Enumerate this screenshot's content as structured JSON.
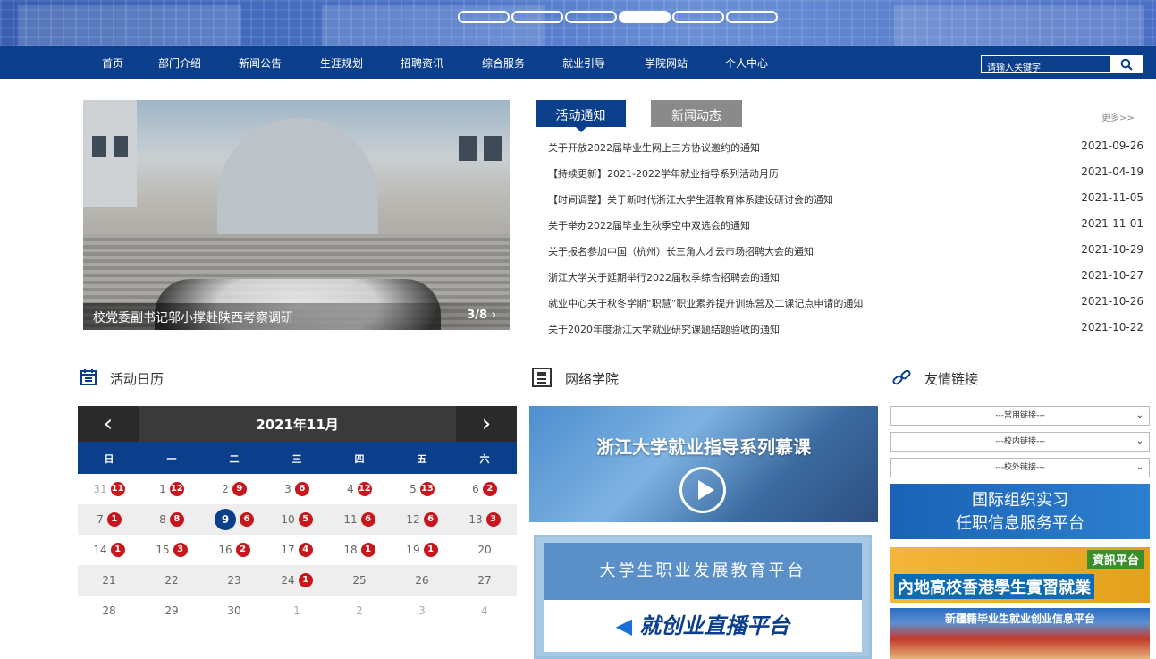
{
  "banner": {
    "dots": [
      false,
      false,
      false,
      true,
      false,
      false
    ]
  },
  "nav": {
    "items": [
      "首页",
      "部门介绍",
      "新闻公告",
      "生涯规划",
      "招聘资讯",
      "综合服务",
      "就业引导",
      "学院网站",
      "个人中心"
    ],
    "search_placeholder": "请输入关键字"
  },
  "slider": {
    "caption": "校党委副书记邬小撑赴陕西考察调研",
    "pager": "3/8"
  },
  "news": {
    "tabs": [
      "活动通知",
      "新闻动态"
    ],
    "more": "更多>>",
    "items": [
      {
        "title": "关于开放2022届毕业生网上三方协议邀约的通知",
        "date": "2021-09-26"
      },
      {
        "title": "【持续更新】2021-2022学年就业指导系列活动月历",
        "date": "2021-04-19"
      },
      {
        "title": "【时间调整】关于新时代浙江大学生涯教育体系建设研讨会的通知",
        "date": "2021-11-05"
      },
      {
        "title": "关于举办2022届毕业生秋季空中双选会的通知",
        "date": "2021-11-01"
      },
      {
        "title": "关于报名参加中国（杭州）长三角人才云市场招聘大会的通知",
        "date": "2021-10-29"
      },
      {
        "title": "浙江大学关于延期举行2022届秋季综合招聘会的通知",
        "date": "2021-10-27"
      },
      {
        "title": "就业中心关于秋冬学期“职慧”职业素养提升训练营及二课记点申请的通知",
        "date": "2021-10-26"
      },
      {
        "title": "关于2020年度浙江大学就业研究课题结题验收的通知",
        "date": "2021-10-22"
      }
    ]
  },
  "sections": {
    "calendar": "活动日历",
    "online": "网络学院",
    "links": "友情链接"
  },
  "calendar": {
    "month": "2021年11月",
    "weekdays": [
      "日",
      "一",
      "二",
      "三",
      "四",
      "五",
      "六"
    ],
    "rows": [
      [
        {
          "d": "31",
          "n": "11",
          "o": true
        },
        {
          "d": "1",
          "n": "12"
        },
        {
          "d": "2",
          "n": "9"
        },
        {
          "d": "3",
          "n": "6"
        },
        {
          "d": "4",
          "n": "12"
        },
        {
          "d": "5",
          "n": "13"
        },
        {
          "d": "6",
          "n": "2"
        }
      ],
      [
        {
          "d": "7",
          "n": "1"
        },
        {
          "d": "8",
          "n": "8"
        },
        {
          "d": "9",
          "n": "6",
          "today": true
        },
        {
          "d": "10",
          "n": "5"
        },
        {
          "d": "11",
          "n": "6"
        },
        {
          "d": "12",
          "n": "6"
        },
        {
          "d": "13",
          "n": "3"
        }
      ],
      [
        {
          "d": "14",
          "n": "1"
        },
        {
          "d": "15",
          "n": "3"
        },
        {
          "d": "16",
          "n": "2"
        },
        {
          "d": "17",
          "n": "4"
        },
        {
          "d": "18",
          "n": "1"
        },
        {
          "d": "19",
          "n": "1"
        },
        {
          "d": "20"
        }
      ],
      [
        {
          "d": "21"
        },
        {
          "d": "22"
        },
        {
          "d": "23"
        },
        {
          "d": "24",
          "n": "1"
        },
        {
          "d": "25"
        },
        {
          "d": "26"
        },
        {
          "d": "27"
        }
      ],
      [
        {
          "d": "28"
        },
        {
          "d": "29"
        },
        {
          "d": "30"
        },
        {
          "d": "1",
          "o": true
        },
        {
          "d": "2",
          "o": true
        },
        {
          "d": "3",
          "o": true
        },
        {
          "d": "4",
          "o": true
        }
      ]
    ]
  },
  "online": {
    "mooc_title": "浙江大学就业指导系列慕课",
    "live_top": "大学生职业发展教育平台",
    "live_bottom": "就创业直播平台"
  },
  "links": {
    "selects": [
      "---常用链接---",
      "---校内链接---",
      "---校外链接---"
    ],
    "ad1_line1": "国际组织实习",
    "ad1_line2": "任职信息服务平台",
    "ad2_tag": "資訊平台",
    "ad2_text": "內地高校香港學生實習就業",
    "ad3_text": "新疆籍毕业生就业创业信息平台"
  },
  "colors": {
    "primary": "#0b3f8c",
    "badge": "#c8161d",
    "tab_inactive": "#8a8a8a"
  }
}
